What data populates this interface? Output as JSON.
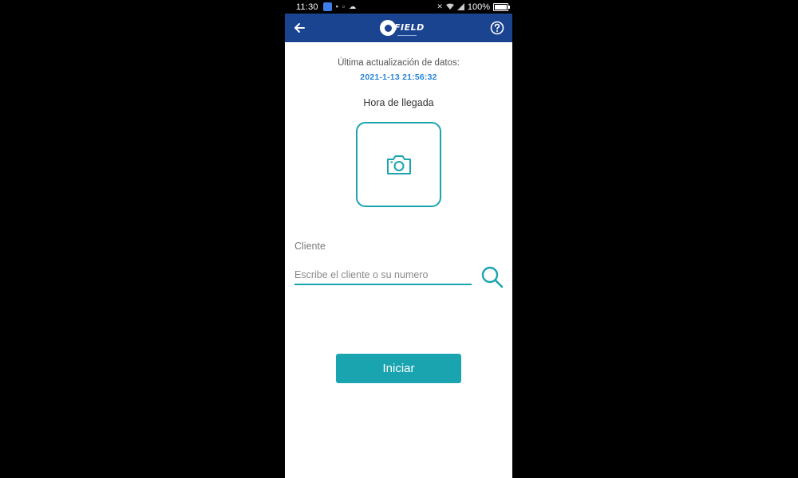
{
  "status_bar": {
    "time": "11:30",
    "battery_text": "100%",
    "battery_level": 1.0,
    "icons_left": [
      "app-notification-icon",
      "chat-icon",
      "image-icon",
      "cloud-icon"
    ],
    "icons_right": [
      "mute-icon",
      "wifi-icon",
      "signal-icon",
      "battery-icon"
    ]
  },
  "app_bar": {
    "logo_text": "FIELD",
    "back_icon": "arrow-left-icon",
    "help_icon": "question-circle-icon",
    "color": "#1a4390"
  },
  "content": {
    "last_update_label": "Última actualización de datos:",
    "last_update_value": "2021-1-13 21:56:32",
    "arrival_title": "Hora de llegada",
    "photo_icon": "camera-icon",
    "client_label": "Cliente",
    "client_input": {
      "value": "",
      "placeholder": "Escribe el cliente o su numero"
    },
    "search_icon": "search-icon",
    "start_button_label": "Iniciar"
  },
  "colors": {
    "accent": "#1aa4b0",
    "date_text": "#2a86d9",
    "background": "#ffffff"
  }
}
